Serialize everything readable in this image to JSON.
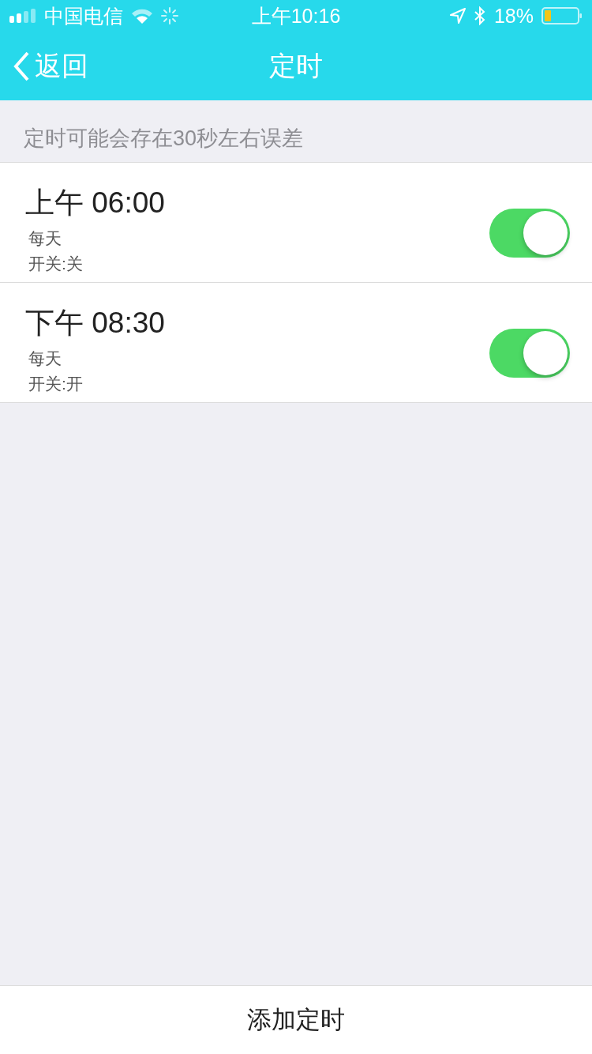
{
  "status_bar": {
    "carrier": "中国电信",
    "time": "上午10:16",
    "battery_percent": "18%"
  },
  "nav_bar": {
    "back": "返回",
    "title": "定时"
  },
  "notice": "定时可能会存在30秒左右误差",
  "timers": [
    {
      "time": "上午 06:00",
      "repeat": "每天",
      "switch_text": "开关:关",
      "on": true
    },
    {
      "time": "下午 08:30",
      "repeat": "每天",
      "switch_text": "开关:开",
      "on": true
    }
  ],
  "add_button": "添加定时"
}
